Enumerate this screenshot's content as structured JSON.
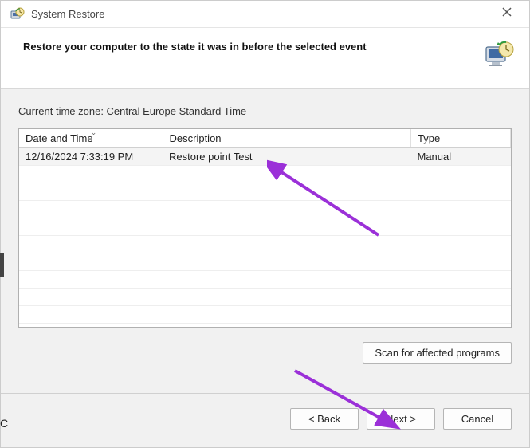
{
  "titlebar": {
    "title": "System Restore"
  },
  "header": {
    "heading": "Restore your computer to the state it was in before the selected event"
  },
  "body": {
    "timezone_label": "Current time zone: Central Europe Standard Time",
    "columns": {
      "datetime": "Date and Time",
      "description": "Description",
      "type": "Type"
    },
    "rows": [
      {
        "datetime": "12/16/2024 7:33:19 PM",
        "description": "Restore point Test",
        "type": "Manual"
      }
    ],
    "scan_button": "Scan for affected programs"
  },
  "footer": {
    "back": "< Back",
    "next": "Next >",
    "cancel": "Cancel"
  },
  "colors": {
    "arrow": "#9b30d8"
  }
}
